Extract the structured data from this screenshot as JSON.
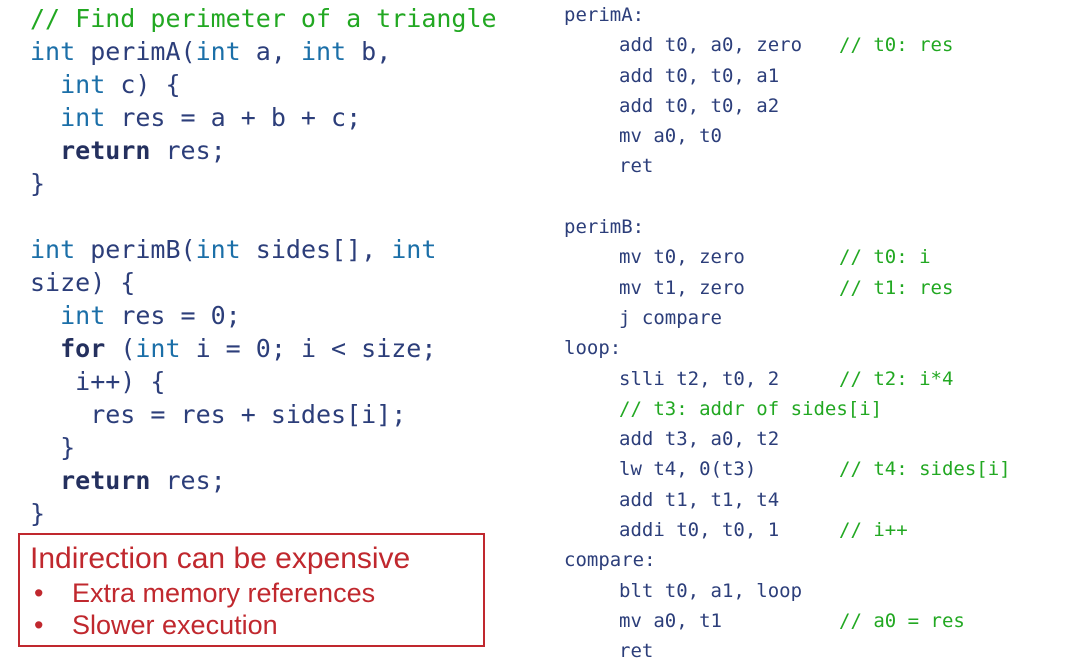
{
  "c_source": {
    "lines": [
      [
        {
          "t": "// Find perimeter of a triangle",
          "c": "cm"
        }
      ],
      [
        {
          "t": "int",
          "c": "kw"
        },
        {
          "t": " perimA(",
          "c": ""
        },
        {
          "t": "int",
          "c": "kw"
        },
        {
          "t": " a, ",
          "c": ""
        },
        {
          "t": "int",
          "c": "kw"
        },
        {
          "t": " b,",
          "c": ""
        }
      ],
      [
        {
          "t": "  ",
          "c": ""
        },
        {
          "t": "int",
          "c": "kw"
        },
        {
          "t": " c) {",
          "c": ""
        }
      ],
      [
        {
          "t": "  ",
          "c": ""
        },
        {
          "t": "int",
          "c": "kw"
        },
        {
          "t": " res = a + b + c;",
          "c": ""
        }
      ],
      [
        {
          "t": "  ",
          "c": ""
        },
        {
          "t": "return",
          "c": "bkw"
        },
        {
          "t": " res;",
          "c": ""
        }
      ],
      [
        {
          "t": "}",
          "c": ""
        }
      ],
      [
        {
          "t": "",
          "c": ""
        }
      ],
      [
        {
          "t": "int",
          "c": "kw"
        },
        {
          "t": " perimB(",
          "c": ""
        },
        {
          "t": "int",
          "c": "kw"
        },
        {
          "t": " sides[], ",
          "c": ""
        },
        {
          "t": "int",
          "c": "kw"
        }
      ],
      [
        {
          "t": "size) {",
          "c": ""
        }
      ],
      [
        {
          "t": "  ",
          "c": ""
        },
        {
          "t": "int",
          "c": "kw"
        },
        {
          "t": " res = 0;",
          "c": ""
        }
      ],
      [
        {
          "t": "  ",
          "c": ""
        },
        {
          "t": "for",
          "c": "bkw"
        },
        {
          "t": " (",
          "c": ""
        },
        {
          "t": "int",
          "c": "kw"
        },
        {
          "t": " i = 0; i < size;",
          "c": ""
        }
      ],
      [
        {
          "t": "   i++) {",
          "c": ""
        }
      ],
      [
        {
          "t": "    res = res + sides[i];",
          "c": ""
        }
      ],
      [
        {
          "t": "  }",
          "c": ""
        }
      ],
      [
        {
          "t": "  ",
          "c": ""
        },
        {
          "t": "return",
          "c": "bkw"
        },
        {
          "t": " res;",
          "c": ""
        }
      ],
      [
        {
          "t": "}",
          "c": ""
        }
      ]
    ]
  },
  "assembly": {
    "lines": [
      {
        "label": "perimA:"
      },
      {
        "instr": "add t0, a0, zero",
        "comment": "// t0: res"
      },
      {
        "instr": "add t0, t0, a1"
      },
      {
        "instr": "add t0, t0, a2"
      },
      {
        "instr": "mv a0, t0"
      },
      {
        "instr": "ret"
      },
      {},
      {
        "label": "perimB:"
      },
      {
        "instr": "mv t0, zero",
        "comment": "// t0: i"
      },
      {
        "instr": "mv t1, zero",
        "comment": "// t1: res"
      },
      {
        "instr": "j compare"
      },
      {
        "label": "loop:"
      },
      {
        "instr": "slli t2, t0, 2",
        "comment": "// t2: i*4"
      },
      {
        "inline_comment": "// t3: addr of sides[i]"
      },
      {
        "instr": "add t3, a0, t2"
      },
      {
        "instr": "lw t4, 0(t3)",
        "comment": "// t4: sides[i]"
      },
      {
        "instr": "add t1, t1, t4"
      },
      {
        "instr": "addi t0, t0, 1",
        "comment": "// i++"
      },
      {
        "label": "compare:"
      },
      {
        "instr": "blt t0, a1, loop"
      },
      {
        "instr": "mv a0, t1",
        "comment": "// a0 = res"
      },
      {
        "instr": "ret"
      }
    ]
  },
  "callout": {
    "title": "Indirection can be expensive",
    "items": [
      "Extra memory references",
      "Slower execution"
    ],
    "bullet": "•"
  }
}
